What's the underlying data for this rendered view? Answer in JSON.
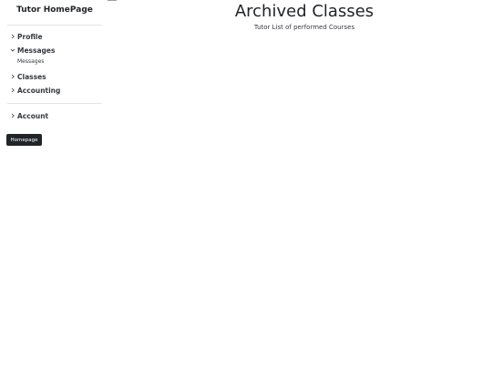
{
  "sidebar": {
    "brand": "Tutor HomePage",
    "items": [
      {
        "label": "Profile",
        "expanded": false
      },
      {
        "label": "Messages",
        "expanded": true,
        "children": [
          "Messages"
        ]
      },
      {
        "label": "Classes",
        "expanded": false
      },
      {
        "label": "Accounting",
        "expanded": false
      }
    ],
    "account": {
      "label": "Account",
      "expanded": false
    },
    "tooltip": "Homepage"
  },
  "main": {
    "title": "Archived Classes",
    "subtitle": "Tutor List of performed Courses"
  },
  "icons": {
    "collapsed": "chevron-right-icon",
    "expanded": "chevron-down-icon"
  }
}
